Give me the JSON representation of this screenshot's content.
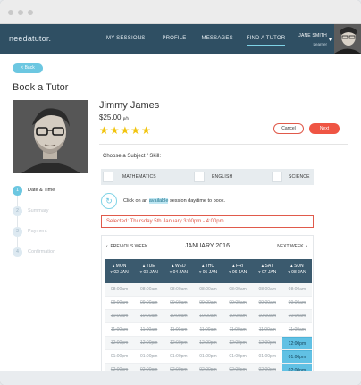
{
  "nav": {
    "brand": "needatutor.",
    "links": [
      "MY SESSIONS",
      "PROFILE",
      "MESSAGES",
      "FIND A TUTOR"
    ],
    "user_name": "JANE SMITH",
    "user_role": "Learner"
  },
  "page": {
    "back_label": "< Back",
    "title": "Book a Tutor"
  },
  "tutor": {
    "name": "Jimmy James",
    "price": "$25.00",
    "price_unit": "p/h",
    "rating": 5
  },
  "actions": {
    "cancel": "Cancel",
    "next": "Next"
  },
  "steps": [
    "Date & Time",
    "Summary",
    "Payment",
    "Confirmation"
  ],
  "step_numbers": [
    "1",
    "2",
    "3",
    "4"
  ],
  "subject": {
    "prompt": "Choose a Subject / Skill:",
    "options": [
      "MATHEMATICS",
      "ENGLISH",
      "SCIENCE"
    ]
  },
  "hint": {
    "before": "Click on an ",
    "highlight": "available",
    "after": " session day/time to book."
  },
  "selected_text": "Selected: Thursday 5th January 3:00pm - 4:00pm",
  "calendar": {
    "prev": "PREVIOUS WEEK",
    "month": "JANUARY 2016",
    "next": "NEXT WEEK",
    "days": [
      {
        "name": "MON",
        "date": "02 JAN"
      },
      {
        "name": "TUE",
        "date": "03 JAN"
      },
      {
        "name": "WED",
        "date": "04 JAN"
      },
      {
        "name": "THU",
        "date": "05 JAN"
      },
      {
        "name": "FRI",
        "date": "06 JAN"
      },
      {
        "name": "SAT",
        "date": "07 JAN"
      },
      {
        "name": "SUN",
        "date": "08 JAN"
      }
    ],
    "times": [
      "08:00am",
      "09:00am",
      "10:00am",
      "11:00am",
      "12:00pm",
      "01:00pm",
      "02:00pm"
    ],
    "available": [
      [
        4,
        6
      ],
      [
        5,
        6
      ],
      [
        6,
        6
      ]
    ]
  },
  "colors": {
    "nav": "#2f4f63",
    "accent": "#6cc7e1",
    "danger": "#ef5544",
    "calendar_header": "#3b5a6e",
    "available": "#61c1e4"
  }
}
